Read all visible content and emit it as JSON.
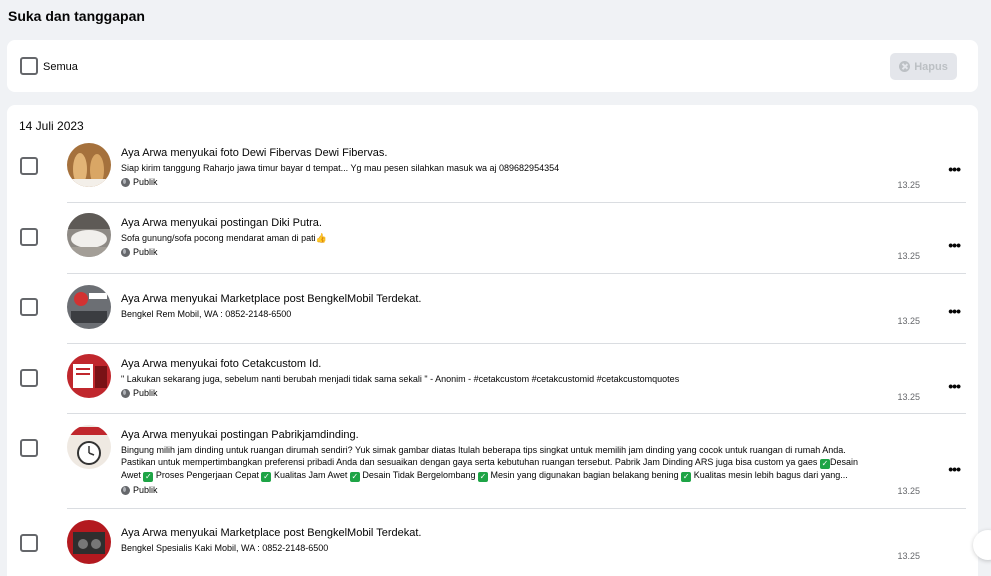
{
  "page": {
    "title": "Suka dan tanggapan"
  },
  "filter": {
    "all_label": "Semua",
    "delete_label": "Hapus"
  },
  "list": {
    "date": "14 Juli 2023",
    "items": [
      {
        "actor": "Aya Arwa",
        "verb": "menyukai",
        "object": "foto Dewi Fibervas Dewi Fibervas.",
        "desc": "Siap kirim tanggung Raharjo jawa timur bayar d tempat... Yg mau pesen silahkan masuk wa aj 089682954354",
        "privacy": "Publik",
        "time": "13.25",
        "thumb_color": "#c58a4a"
      },
      {
        "actor": "Aya Arwa",
        "verb": "menyukai",
        "object": "postingan Diki Putra.",
        "desc": "Sofa gunung/sofa pocong mendarat aman di pati👍",
        "privacy": "Publik",
        "time": "13.25",
        "thumb_color": "#b9b5ae"
      },
      {
        "actor": "Aya Arwa",
        "verb": "menyukai",
        "object": "Marketplace post BengkelMobil Terdekat.",
        "desc": "Bengkel Rem Mobil, WA : 0852-2148-6500",
        "privacy": "",
        "time": "13.25",
        "thumb_color": "#6c6f74"
      },
      {
        "actor": "Aya Arwa",
        "verb": "menyukai",
        "object": "foto Cetakcustom Id.",
        "desc": "\" Lakukan sekarang juga, sebelum nanti berubah menjadi tidak sama sekali \" - Anonim - #cetakcustom #cetakcustomid #cetakcustomquotes",
        "privacy": "Publik",
        "time": "13.25",
        "thumb_color": "#c0272d"
      },
      {
        "actor": "Aya Arwa",
        "verb": "menyukai",
        "object": "postingan Pabrikjamdinding.",
        "desc_lines": [
          "Bingung milih jam dinding untuk ruangan dirumah sendiri? Yuk simak gambar diatas Itulah beberapa tips singkat untuk memilih jam dinding yang cocok untuk ruangan di rumah Anda.",
          "Pastikan untuk mempertimbangkan preferensi pribadi Anda dan sesuaikan dengan gaya serta kebutuhan ruangan tersebut. Pabrik Jam Dinding ARS juga bisa custom ya gaes",
          "Desain"
        ],
        "desc_line3": [
          "Awet",
          "Proses Pengerjaan Cepat",
          "Kualitas Jam Awet",
          "Desain Tidak Bergelombang",
          "Mesin yang digunakan bagian belakang bening",
          "Kualitas mesin lebih bagus dari yang..."
        ],
        "privacy": "Publik",
        "time": "13.25",
        "thumb_color": "#d8d2cb"
      },
      {
        "actor": "Aya Arwa",
        "verb": "menyukai",
        "object": "Marketplace post BengkelMobil Terdekat.",
        "desc": "Bengkel Spesialis Kaki Mobil, WA : 0852-2148-6500",
        "privacy": "",
        "time": "13.25",
        "thumb_color": "#b3191f"
      }
    ]
  },
  "icons": {
    "checkbox": "checkbox-icon",
    "more": "more-options-icon",
    "globe": "globe-icon",
    "check": "green-check-icon",
    "clear": "clear-icon"
  }
}
